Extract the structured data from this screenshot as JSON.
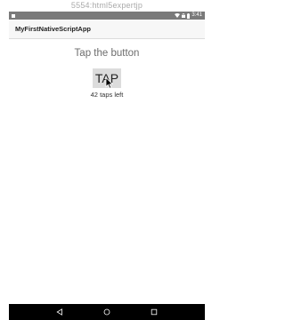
{
  "window": {
    "title": "5554:html5expertjp"
  },
  "status_bar": {
    "time": "3:41",
    "icons": [
      "notification-icon",
      "wifi-icon",
      "lock-icon",
      "battery-icon"
    ]
  },
  "action_bar": {
    "title": "MyFirstNativeScriptApp"
  },
  "main": {
    "heading": "Tap the button",
    "button_label": "TAP",
    "taps_left": "42 taps left"
  },
  "nav_bar": {
    "buttons": [
      "back-icon",
      "home-icon",
      "recents-icon"
    ]
  },
  "colors": {
    "status_bar": "#7a7a7a",
    "action_bar": "#f7f7f7",
    "button_bg": "#dcdcdc",
    "nav_bar": "#000000"
  }
}
